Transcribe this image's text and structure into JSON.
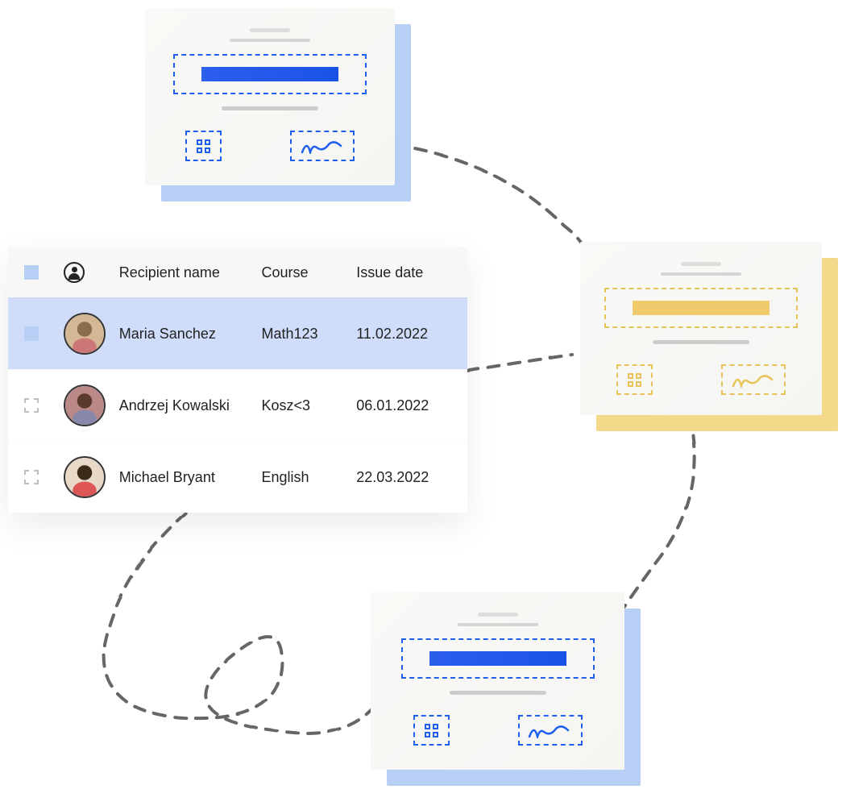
{
  "table": {
    "headers": {
      "recipient_name": "Recipient name",
      "course": "Course",
      "issue_date": "Issue date"
    },
    "rows": [
      {
        "selected": true,
        "name": "Maria Sanchez",
        "course": "Math123",
        "issue_date": "11.02.2022"
      },
      {
        "selected": false,
        "name": "Andrzej Kowalski",
        "course": "Kosz<3",
        "issue_date": "06.01.2022"
      },
      {
        "selected": false,
        "name": "Michael Bryant",
        "course": "English",
        "issue_date": "22.03.2022"
      }
    ]
  },
  "certificates": {
    "top": {
      "color": "blue"
    },
    "right": {
      "color": "yellow"
    },
    "bottom": {
      "color": "blue"
    }
  },
  "colors": {
    "blue": "#1f5ff0",
    "yellow": "#e8c35a",
    "row_selected": "#d0ddfa"
  }
}
